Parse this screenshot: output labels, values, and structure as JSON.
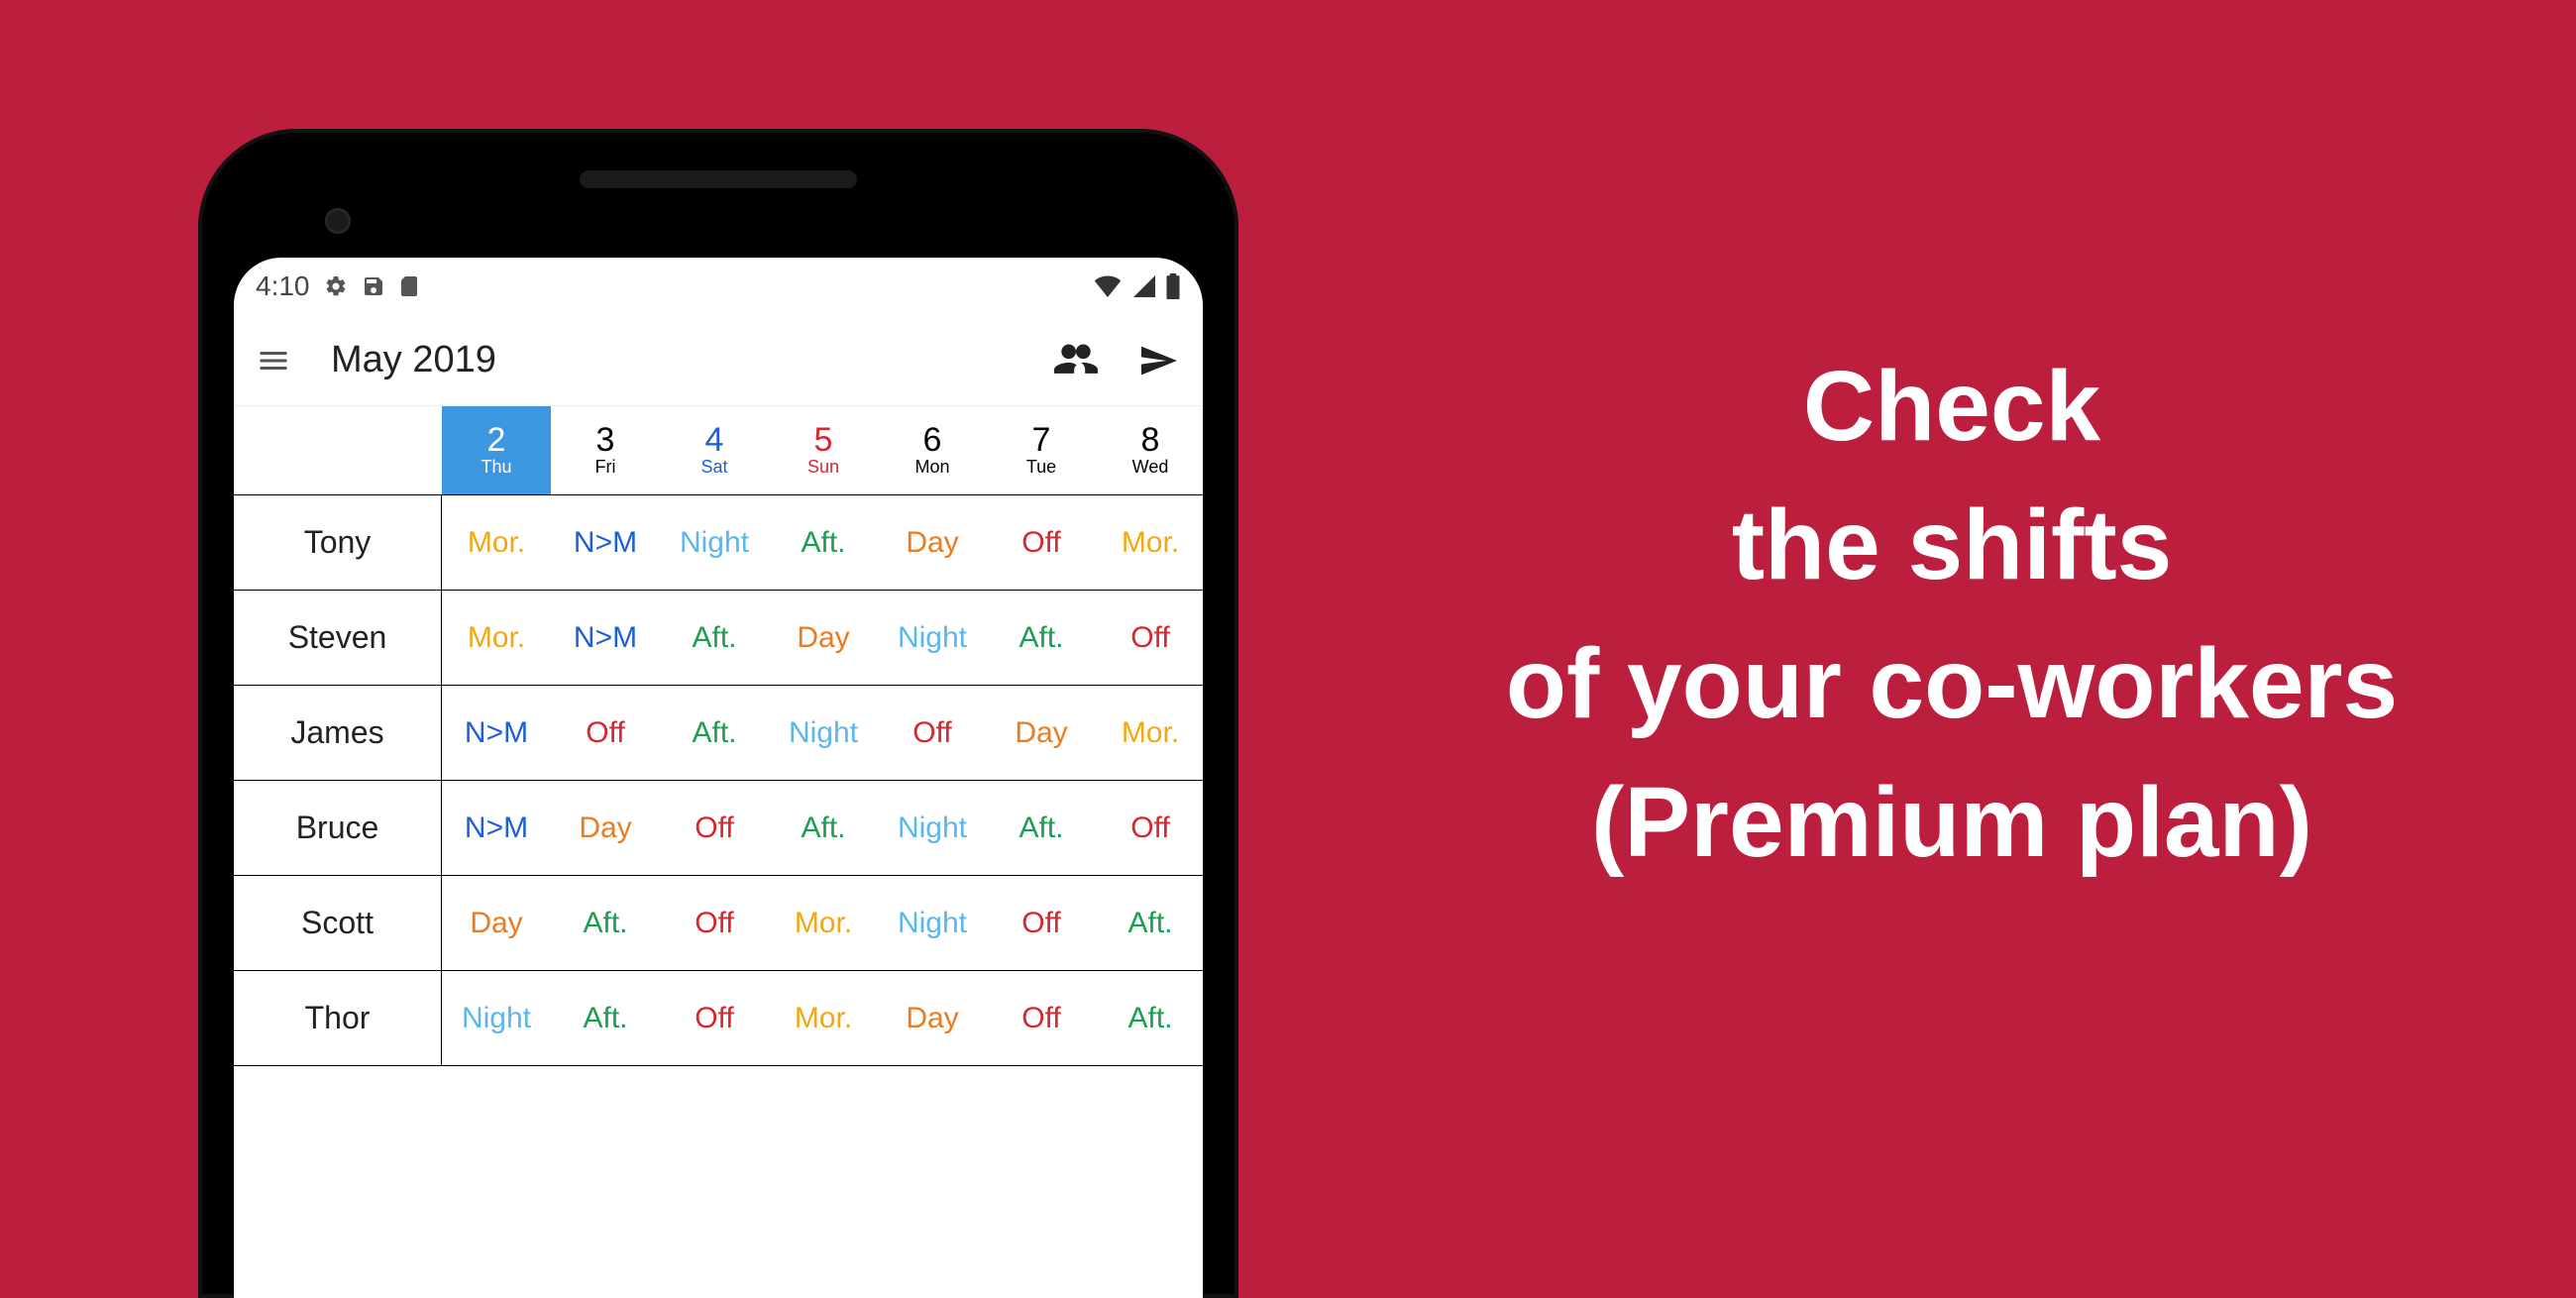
{
  "promo": {
    "line1": "Check",
    "line2": "the shifts",
    "line3": "of your co-workers",
    "line4": "(Premium plan)"
  },
  "status_bar": {
    "time": "4:10"
  },
  "app_bar": {
    "title": "May 2019"
  },
  "days": [
    {
      "num": "2",
      "label": "Thu",
      "kind": "selected"
    },
    {
      "num": "3",
      "label": "Fri",
      "kind": ""
    },
    {
      "num": "4",
      "label": "Sat",
      "kind": "sat"
    },
    {
      "num": "5",
      "label": "Sun",
      "kind": "sun"
    },
    {
      "num": "6",
      "label": "Mon",
      "kind": ""
    },
    {
      "num": "7",
      "label": "Tue",
      "kind": ""
    },
    {
      "num": "8",
      "label": "Wed",
      "kind": ""
    }
  ],
  "workers": [
    {
      "name": "Tony",
      "shifts": [
        {
          "t": "Mor.",
          "c": "mor"
        },
        {
          "t": "N>M",
          "c": "nm"
        },
        {
          "t": "Night",
          "c": "night"
        },
        {
          "t": "Aft.",
          "c": "aft"
        },
        {
          "t": "Day",
          "c": "day"
        },
        {
          "t": "Off",
          "c": "off"
        },
        {
          "t": "Mor.",
          "c": "mor"
        }
      ]
    },
    {
      "name": "Steven",
      "shifts": [
        {
          "t": "Mor.",
          "c": "mor"
        },
        {
          "t": "N>M",
          "c": "nm"
        },
        {
          "t": "Aft.",
          "c": "aft"
        },
        {
          "t": "Day",
          "c": "day"
        },
        {
          "t": "Night",
          "c": "night"
        },
        {
          "t": "Aft.",
          "c": "aft"
        },
        {
          "t": "Off",
          "c": "off"
        }
      ]
    },
    {
      "name": "James",
      "shifts": [
        {
          "t": "N>M",
          "c": "nm"
        },
        {
          "t": "Off",
          "c": "off"
        },
        {
          "t": "Aft.",
          "c": "aft"
        },
        {
          "t": "Night",
          "c": "night"
        },
        {
          "t": "Off",
          "c": "off"
        },
        {
          "t": "Day",
          "c": "day"
        },
        {
          "t": "Mor.",
          "c": "mor"
        }
      ]
    },
    {
      "name": "Bruce",
      "shifts": [
        {
          "t": "N>M",
          "c": "nm"
        },
        {
          "t": "Day",
          "c": "day"
        },
        {
          "t": "Off",
          "c": "off"
        },
        {
          "t": "Aft.",
          "c": "aft"
        },
        {
          "t": "Night",
          "c": "night"
        },
        {
          "t": "Aft.",
          "c": "aft"
        },
        {
          "t": "Off",
          "c": "off"
        }
      ]
    },
    {
      "name": "Scott",
      "shifts": [
        {
          "t": "Day",
          "c": "day"
        },
        {
          "t": "Aft.",
          "c": "aft"
        },
        {
          "t": "Off",
          "c": "off"
        },
        {
          "t": "Mor.",
          "c": "mor"
        },
        {
          "t": "Night",
          "c": "night"
        },
        {
          "t": "Off",
          "c": "off"
        },
        {
          "t": "Aft.",
          "c": "aft"
        }
      ]
    },
    {
      "name": "Thor",
      "shifts": [
        {
          "t": "Night",
          "c": "night"
        },
        {
          "t": "Aft.",
          "c": "aft"
        },
        {
          "t": "Off",
          "c": "off"
        },
        {
          "t": "Mor.",
          "c": "mor"
        },
        {
          "t": "Day",
          "c": "day"
        },
        {
          "t": "Off",
          "c": "off"
        },
        {
          "t": "Aft.",
          "c": "aft"
        }
      ]
    }
  ]
}
